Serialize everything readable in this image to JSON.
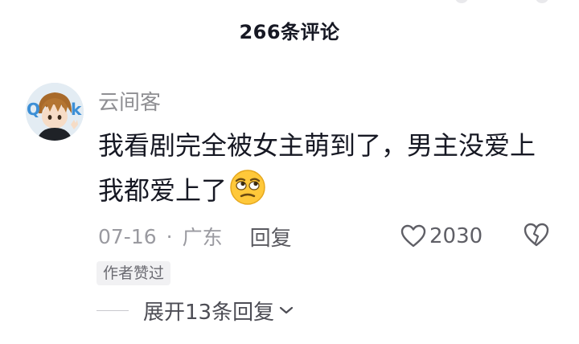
{
  "header": {
    "title": "266条评论"
  },
  "comment": {
    "username": "云间客",
    "text": "我看剧完全被女主萌到了，男主没爱上我都爱上了",
    "emoji": "rolling-eyes-emoji",
    "date": "07-16",
    "separator": "·",
    "location": "广东",
    "reply_label": "回复",
    "like_count": "2030",
    "author_badge": "作者赞过",
    "expand_replies_label": "展开13条回复"
  },
  "colors": {
    "text_primary": "#161823",
    "text_secondary": "#8f8f93",
    "badge_bg": "#f1f1f3",
    "icon": "#5f5f66"
  },
  "icons": {
    "like": "heart-outline-icon",
    "dislike": "broken-heart-icon",
    "expand": "chevron-down-icon"
  }
}
